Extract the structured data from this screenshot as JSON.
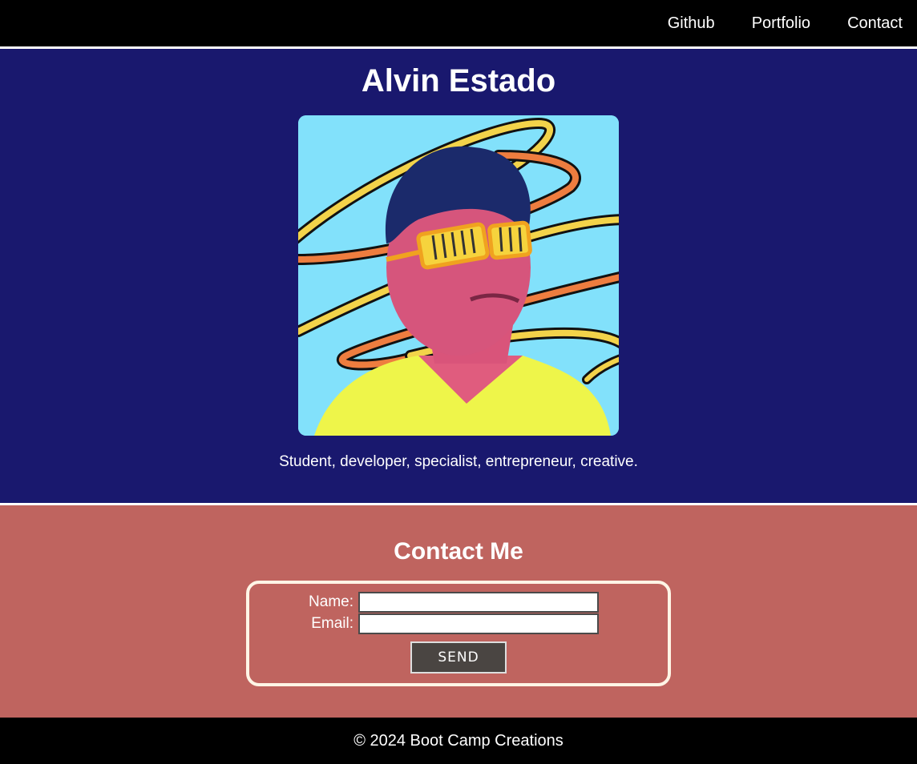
{
  "nav": {
    "items": [
      {
        "label": "Github"
      },
      {
        "label": "Portfolio"
      },
      {
        "label": "Contact"
      }
    ]
  },
  "hero": {
    "name": "Alvin Estado",
    "tagline": "Student, developer, specialist, entrepreneur, creative."
  },
  "contact": {
    "title": "Contact Me",
    "name_label": "Name:",
    "name_value": "",
    "email_label": "Email:",
    "email_value": "",
    "send_label": "SEND"
  },
  "footer": {
    "text": "© 2024 Boot Camp Creations"
  },
  "colors": {
    "hero_bg": "#19186e",
    "contact_bg": "#bf645f",
    "portrait_bg": "#82e1fb",
    "button_bg": "#4a4542"
  }
}
